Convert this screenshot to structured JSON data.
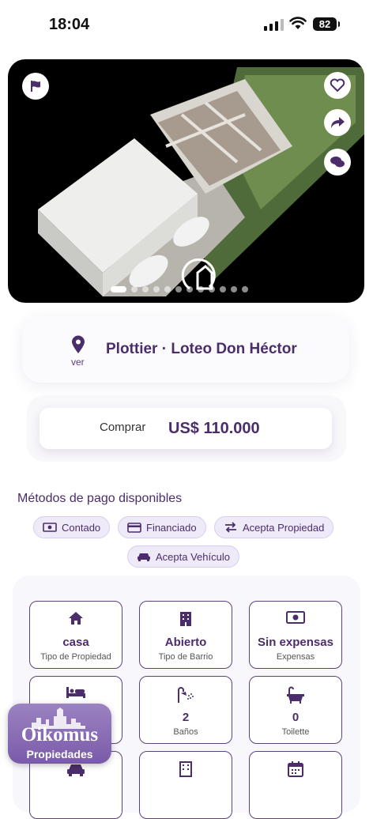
{
  "status_bar": {
    "time": "18:04",
    "battery": "82"
  },
  "hero": {
    "image_alt": "3D floor plan render of house",
    "slide_count": 12,
    "active_slide": 1
  },
  "location": {
    "title": "Plottier · Loteo Don Héctor",
    "link": "ver"
  },
  "price": {
    "label": "Comprar",
    "value": "US$ 110.000"
  },
  "payment": {
    "title": "Métodos de pago disponibles",
    "methods": [
      "Contado",
      "Financiado",
      "Acepta Propiedad",
      "Acepta Vehículo"
    ]
  },
  "features": [
    {
      "icon": "home-icon",
      "value": "casa",
      "label": "Tipo de Propiedad"
    },
    {
      "icon": "building-icon",
      "value": "Abierto",
      "label": "Tipo de Barrio"
    },
    {
      "icon": "money-icon",
      "value": "Sin expensas",
      "label": "Expensas"
    },
    {
      "icon": "bed-icon",
      "value": "",
      "label": ""
    },
    {
      "icon": "shower-icon",
      "value": "2",
      "label": "Baños"
    },
    {
      "icon": "bathtub-icon",
      "value": "0",
      "label": "Toilette"
    },
    {
      "icon": "car-icon",
      "value": "",
      "label": ""
    },
    {
      "icon": "building-icon",
      "value": "",
      "label": ""
    },
    {
      "icon": "calendar-icon",
      "value": "",
      "label": ""
    }
  ],
  "brand": {
    "name": "Oikomus",
    "subtitle": "Propiedades"
  },
  "colors": {
    "primary": "#4b2d6b",
    "chip_bg": "#efeaf8",
    "brand_bg": "#8a6bb8"
  }
}
